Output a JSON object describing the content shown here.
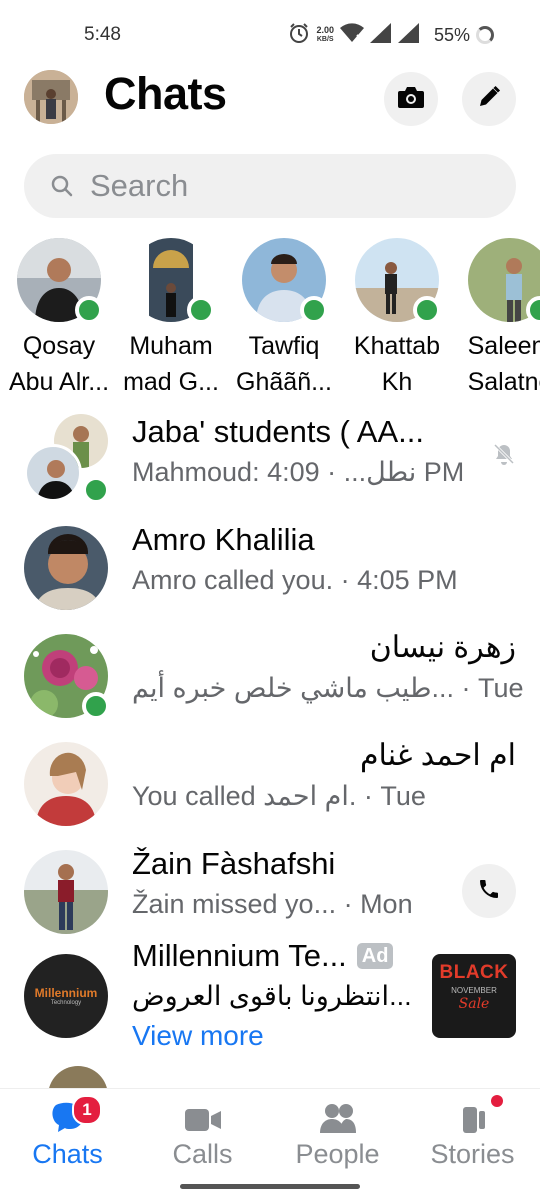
{
  "status_bar": {
    "time": "5:48",
    "speed_value": "2.00",
    "speed_unit": "KB/S",
    "battery": "55%"
  },
  "header": {
    "title": "Chats",
    "icons": [
      "profile-avatar",
      "camera-icon",
      "pencil-icon"
    ]
  },
  "search": {
    "placeholder": "Search"
  },
  "active_users": [
    {
      "line1": "Qosay",
      "line2": "Abu Alr..."
    },
    {
      "line1": "Muham",
      "line2": "mad G..."
    },
    {
      "line1": "Tawfiq",
      "line2": "Ghããñ..."
    },
    {
      "line1": "Khattab",
      "line2": "Kh"
    },
    {
      "line1": "Saleem",
      "line2": "Salatne"
    }
  ],
  "chats": [
    {
      "name": "Jaba' students ( AA...",
      "subtitle": "Mahmoud: نطل... · 4:09 PM",
      "muted": true
    },
    {
      "name": "Amro Khalilia",
      "subtitle": "Amro called you. · 4:05 PM"
    },
    {
      "name": "زهرة نيسان",
      "subtitle": "طيب ماشي  خلص خبره أيم... · Tue"
    },
    {
      "name": "ام احمد غنام",
      "subtitle": "You called ام احمد. · Tue"
    },
    {
      "name": "Žain Fàshafshi",
      "subtitle": "Žain missed yo...  · Mon"
    },
    {
      "name": "Millennium Te...",
      "badge": "Ad",
      "subtitle": "انتظرونا باقوى العروض...",
      "link": "View more",
      "avatar_text": "Millennium",
      "avatar_subtext": "Technology",
      "thumb_line1": "BLACK",
      "thumb_line2": "NOVEMBER",
      "thumb_line3": "Sale"
    }
  ],
  "bottom_nav": {
    "chats": {
      "label": "Chats",
      "badge": "1"
    },
    "calls": {
      "label": "Calls"
    },
    "people": {
      "label": "People"
    },
    "stories": {
      "label": "Stories"
    }
  },
  "colors": {
    "accent": "#1877f2",
    "online": "#31a24c",
    "badge": "#e41e3f"
  }
}
